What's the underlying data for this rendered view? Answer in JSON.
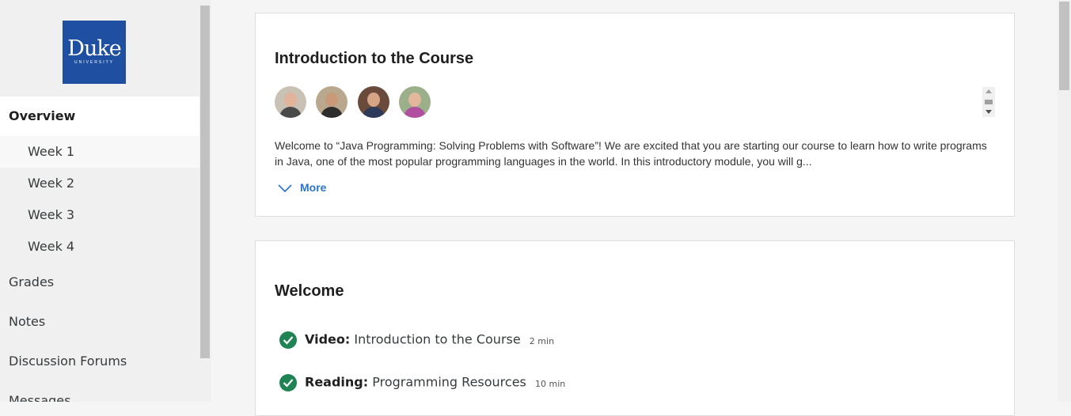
{
  "sidebar": {
    "logo": {
      "brand": "Duke",
      "sub": "UNIVERSITY"
    },
    "overview_label": "Overview",
    "weeks": [
      "Week 1",
      "Week 2",
      "Week 3",
      "Week 4"
    ],
    "items": [
      "Grades",
      "Notes",
      "Discussion Forums",
      "Messages"
    ]
  },
  "intro_card": {
    "title": "Introduction to the Course",
    "description": "Welcome to “Java Programming: Solving Problems with Software”! We are excited that you are starting our course to learn how to write programs in Java, one of the most popular programming languages in the world. In this introductory module, you will g...",
    "more_label": "More"
  },
  "welcome_card": {
    "title": "Welcome",
    "items": [
      {
        "kind": "Video:",
        "title": "Introduction to the Course",
        "duration": "2 min"
      },
      {
        "kind": "Reading:",
        "title": "Programming Resources",
        "duration": "10 min"
      }
    ]
  },
  "colors": {
    "accent": "#2a73cc",
    "complete": "#1f8354",
    "logo_bg": "#1f4fa0"
  }
}
